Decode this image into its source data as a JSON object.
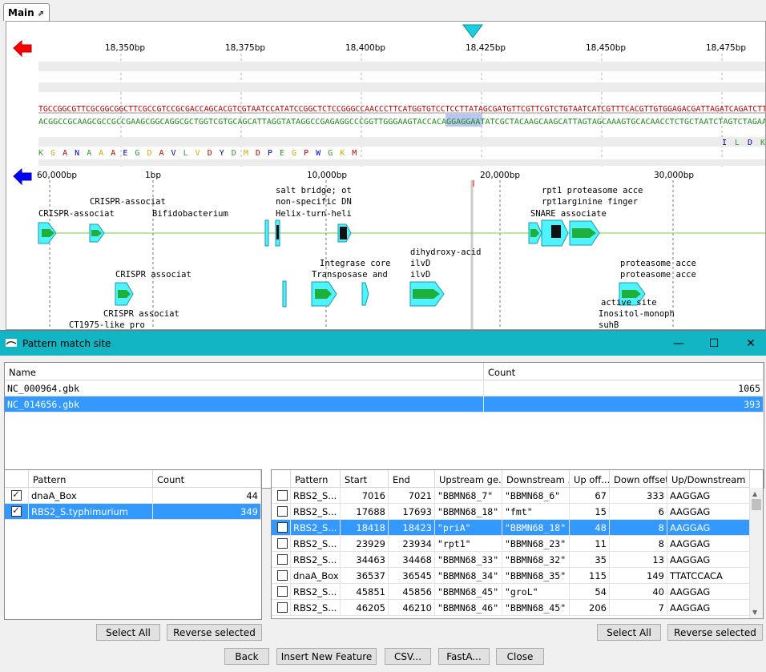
{
  "tab": {
    "label": "Main",
    "pin": "⇗"
  },
  "viewer": {
    "ruler_top": [
      "18,350bp",
      "18,375bp",
      "18,400bp",
      "18,425bp",
      "18,450bp",
      "18,475bp"
    ],
    "seq_forward": "TGCCGGCGTTCGCGGCGGCTTCGCCGTCCGCGACCAGCACGTCGTAATCCATATCCGGCTCTCCGGGCCAACCCTTCATGGTGTCCTCCTTATAGCGATGTTCGTTCGTCTGTAATCATCGTTTCACGTTGTGGAGACGATTAGATCAGATCTT",
    "seq_reverse": "ACGGCCGCAAGCGCCGCCGAAGCGGCAGGCGCTGGTCGTGCAGCATTAGGTATAGGCCGAGAGGCCCGGTTGGGAAGTACCACAGGAGGAATATCGCTACAAGCAAGCATTAGTAGCAAAGTGCACAACCTCTGCTAATCTAGTCTAGAA",
    "aa_left": [
      "K",
      "G",
      "A",
      "N",
      "A",
      "A",
      "A",
      "E",
      "G",
      "D",
      "A",
      "V",
      "L",
      "V",
      "D",
      "Y",
      "D",
      "M",
      "D",
      "P",
      "E",
      "G",
      "P",
      "W",
      "G",
      "K",
      "M"
    ],
    "aa_right": [
      "I",
      "L",
      "D",
      "K"
    ],
    "ruler_bottom": [
      "60,000bp",
      "1bp",
      "10,000bp",
      "20,000bp",
      "30,000bp"
    ],
    "feature_labels": [
      "CRISPR-associat",
      "CRISPR-associat",
      "Bifidobacterium",
      "salt bridge; ot",
      "non-specific DN",
      "Helix-turn-heli",
      "rpt1  proteasome acce",
      "rpt1arginine finger",
      "SNARE associate",
      "Integrase core",
      "Transposase and",
      "dihydroxy-acid",
      "ilvD",
      "ilvD",
      "CRISPR associat",
      "CRISPR associat",
      "CT1975-like pro",
      "proteasome acce",
      "proteasome acce",
      "active site",
      "Inositol-monoph",
      "suhB"
    ],
    "colors": {
      "forward_arrow": "#ff0000",
      "reverse_arrow": "#0000ff",
      "feature_fill": "#4ff3ff",
      "feature_inner": "#1fb03a",
      "backbone": "#77cc44",
      "marker": "#1ccfe0"
    }
  },
  "dialog": {
    "title": "Pattern match site",
    "files": {
      "headers": [
        "Name",
        "Count"
      ],
      "rows": [
        {
          "name": "NC_000964.gbk",
          "count": "1065",
          "selected": false
        },
        {
          "name": "NC_014656.gbk",
          "count": "393",
          "selected": true
        }
      ]
    },
    "patterns": {
      "headers": [
        "Pattern",
        "Count"
      ],
      "rows": [
        {
          "checked": true,
          "name": "dnaA_Box",
          "count": "44",
          "selected": false
        },
        {
          "checked": true,
          "name": "RBS2_S.typhimurium",
          "count": "349",
          "selected": true
        }
      ]
    },
    "matches": {
      "headers": [
        "Pattern",
        "Start",
        "End",
        "Upstream ge...",
        "Downstream ...",
        "Up off...",
        "Down offset",
        "Up/Downstream"
      ],
      "rows": [
        {
          "pattern": "RBS2_S...",
          "start": "7016",
          "end": "7021",
          "up": "\"BBMN68_7\"",
          "down": "\"BBMN68_6\"",
          "upoff": "67",
          "downoff": "333",
          "seq": "AAGGAG",
          "selected": false
        },
        {
          "pattern": "RBS2_S...",
          "start": "17688",
          "end": "17693",
          "up": "\"BBMN68_18\"",
          "down": "\"fmt\"",
          "upoff": "15",
          "downoff": "6",
          "seq": "AAGGAG",
          "selected": false
        },
        {
          "pattern": "RBS2_S...",
          "start": "18418",
          "end": "18423",
          "up": "\"priA\"",
          "down": "\"BBMN68_18\"",
          "upoff": "48",
          "downoff": "8",
          "seq": "AAGGAG",
          "selected": true
        },
        {
          "pattern": "RBS2_S...",
          "start": "23929",
          "end": "23934",
          "up": "\"rpt1\"",
          "down": "\"BBMN68_23\"",
          "upoff": "11",
          "downoff": "8",
          "seq": "AAGGAG",
          "selected": false
        },
        {
          "pattern": "RBS2_S...",
          "start": "34463",
          "end": "34468",
          "up": "\"BBMN68_33\"",
          "down": "\"BBMN68_32\"",
          "upoff": "35",
          "downoff": "13",
          "seq": "AAGGAG",
          "selected": false
        },
        {
          "pattern": "dnaA_Box",
          "start": "36537",
          "end": "36545",
          "up": "\"BBMN68_34\"",
          "down": "\"BBMN68_35\"",
          "upoff": "115",
          "downoff": "149",
          "seq": "TTATCCACA",
          "selected": false
        },
        {
          "pattern": "RBS2_S...",
          "start": "45851",
          "end": "45856",
          "up": "\"BBMN68_45\"",
          "down": "\"groL\"",
          "upoff": "54",
          "downoff": "40",
          "seq": "AAGGAG",
          "selected": false
        },
        {
          "pattern": "RBS2_S...",
          "start": "46205",
          "end": "46210",
          "up": "\"BBMN68_46\"",
          "down": "\"BBMN68_45\"",
          "upoff": "206",
          "downoff": "7",
          "seq": "AAGGAG",
          "selected": false
        }
      ]
    },
    "buttons": {
      "select_all": "Select All",
      "reverse_selected": "Reverse selected",
      "back": "Back",
      "insert": "Insert New Feature",
      "csv": "CSV...",
      "fasta": "FastA...",
      "close": "Close"
    }
  }
}
